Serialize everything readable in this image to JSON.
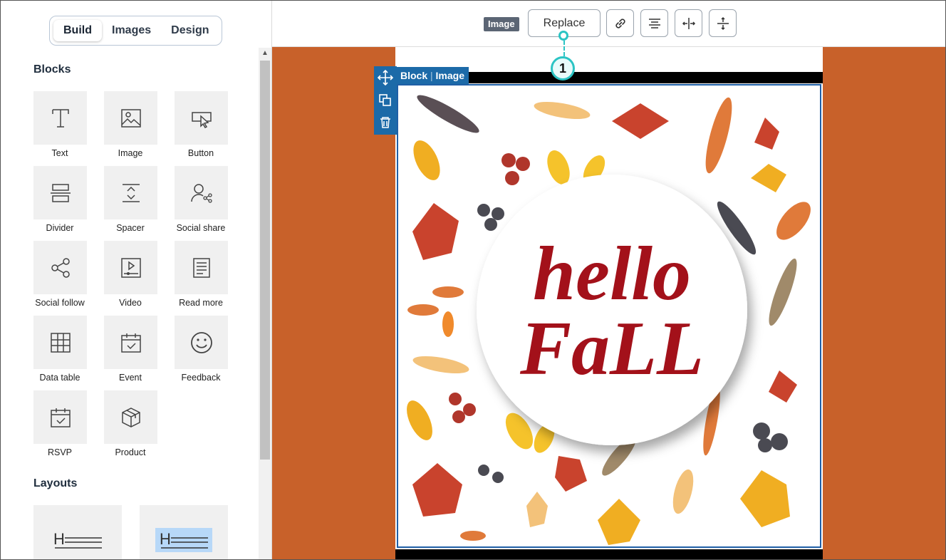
{
  "sidebar": {
    "tabs": [
      {
        "label": "Build",
        "active": true
      },
      {
        "label": "Images",
        "active": false
      },
      {
        "label": "Design",
        "active": false
      }
    ],
    "blocks_title": "Blocks",
    "blocks": [
      {
        "label": "Text",
        "icon": "text-icon"
      },
      {
        "label": "Image",
        "icon": "image-icon"
      },
      {
        "label": "Button",
        "icon": "button-icon"
      },
      {
        "label": "Divider",
        "icon": "divider-icon"
      },
      {
        "label": "Spacer",
        "icon": "spacer-icon"
      },
      {
        "label": "Social share",
        "icon": "social-share-icon"
      },
      {
        "label": "Social follow",
        "icon": "social-follow-icon"
      },
      {
        "label": "Video",
        "icon": "video-icon"
      },
      {
        "label": "Read more",
        "icon": "read-more-icon"
      },
      {
        "label": "Data table",
        "icon": "data-table-icon"
      },
      {
        "label": "Event",
        "icon": "event-icon"
      },
      {
        "label": "Feedback",
        "icon": "feedback-icon"
      },
      {
        "label": "RSVP",
        "icon": "rsvp-icon"
      },
      {
        "label": "Product",
        "icon": "product-icon"
      }
    ],
    "layouts_title": "Layouts"
  },
  "toolbar": {
    "badge": "Image",
    "replace_label": "Replace",
    "buttons": [
      "link-icon",
      "align-center-icon",
      "fit-width-icon",
      "fit-height-icon"
    ]
  },
  "canvas": {
    "block_label": "Block",
    "block_type": "Image",
    "image_text_line1": "hello",
    "image_text_line2": "FaLL",
    "background_color": "#c8612a",
    "accent_color": "#1c6aa8"
  },
  "callout": {
    "number": "1"
  }
}
